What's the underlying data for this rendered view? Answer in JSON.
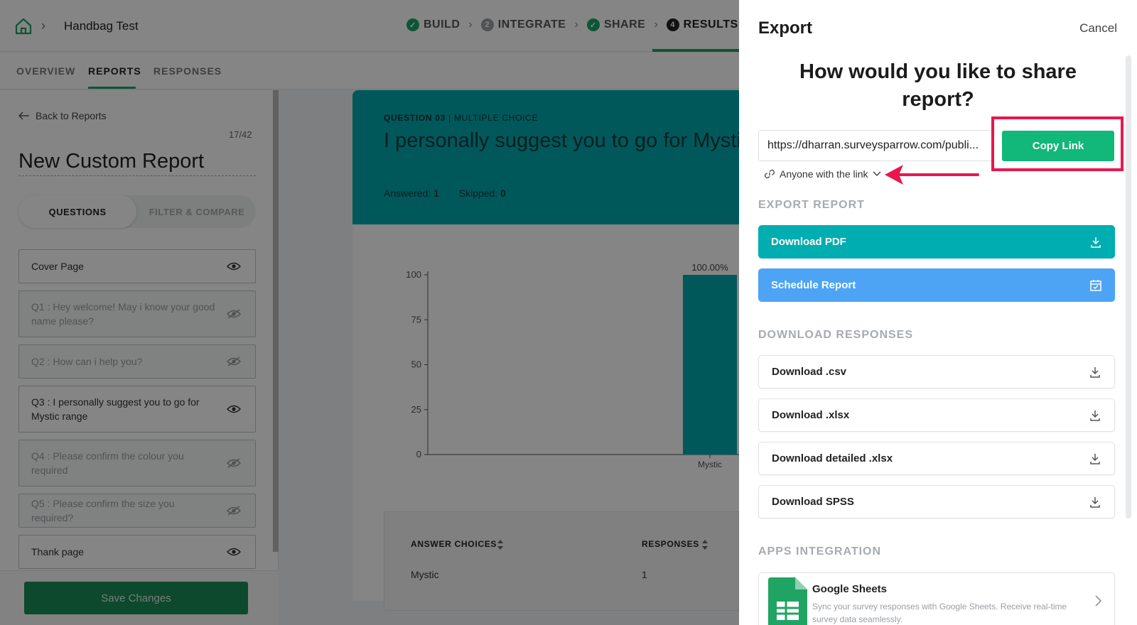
{
  "header": {
    "project_title": "Handbag Test",
    "steps": [
      {
        "label": "BUILD",
        "marker": "✓"
      },
      {
        "label": "INTEGRATE",
        "marker": "2"
      },
      {
        "label": "SHARE",
        "marker": "✓"
      },
      {
        "label": "RESULTS",
        "marker": "4"
      }
    ]
  },
  "subnav": {
    "tabs": [
      "OVERVIEW",
      "REPORTS",
      "RESPONSES"
    ],
    "active": "REPORTS"
  },
  "sidebar": {
    "back_label": "Back to Reports",
    "counter": "17/42",
    "report_title": "New Custom Report",
    "toggle": {
      "questions": "QUESTIONS",
      "filter": "FILTER & COMPARE"
    },
    "items": [
      {
        "label": "Cover Page"
      },
      {
        "label": "Q1 : Hey welcome! May i know your good name please?"
      },
      {
        "label": "Q2 : How can i help you?"
      },
      {
        "label": "Q3 : I personally suggest you to go for Mystic range"
      },
      {
        "label": "Q4 : Please confirm the colour you required"
      },
      {
        "label": "Q5 : Please confirm the size you required?"
      },
      {
        "label": "Thank page"
      }
    ],
    "save_label": "Save Changes"
  },
  "question_card": {
    "type_bold": "QUESTION 03",
    "type_rest": " | MULTIPLE CHOICE",
    "text": "I personally suggest you to go for Mystic r",
    "answered_label": "Answered:",
    "answered_value": "1",
    "skipped_label": "Skipped:",
    "skipped_value": "0"
  },
  "chart_data": {
    "type": "bar",
    "categories": [
      "Mystic"
    ],
    "values": [
      100
    ],
    "data_labels": [
      "100.00%"
    ],
    "yticks": [
      "100",
      "75",
      "50",
      "25",
      "0"
    ],
    "ylim": [
      0,
      100
    ],
    "color": "#00a9ac"
  },
  "answer_table": {
    "headers": [
      "ANSWER CHOICES",
      "RESPONSES"
    ],
    "rows": [
      [
        "Mystic",
        "1"
      ]
    ]
  },
  "export_panel": {
    "title": "Export",
    "cancel_label": "Cancel",
    "heading": "How would you like to share report?",
    "share_url": "https://dharran.surveysparrow.com/publi...",
    "copy_label": "Copy Link",
    "access_label": "Anyone with the link",
    "export_report_label": "EXPORT REPORT",
    "download_pdf_label": "Download PDF",
    "schedule_label": "Schedule Report",
    "download_responses_label": "DOWNLOAD RESPONSES",
    "downloads": [
      "Download .csv",
      "Download .xlsx",
      "Download detailed .xlsx",
      "Download SPSS"
    ],
    "apps_label": "APPS INTEGRATION",
    "integration": {
      "title": "Google Sheets",
      "description": "Sync your survey responses with Google Sheets. Receive real-time survey data seamlessly."
    }
  },
  "colors": {
    "brand_green": "#1aa46a",
    "teal": "#00adb0",
    "blue": "#4da4f4",
    "highlight_red": "#e8174e"
  }
}
